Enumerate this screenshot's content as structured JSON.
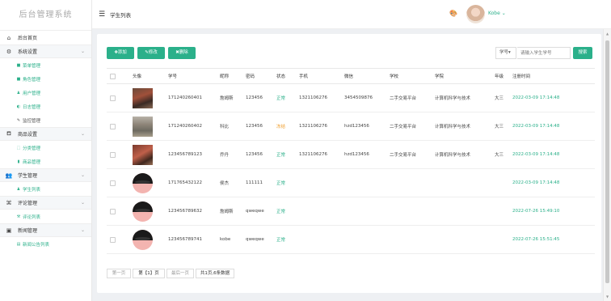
{
  "sidebar": {
    "logo": "后台管理系统",
    "home": "后台首页",
    "groups": [
      {
        "label": "系统设置",
        "items": [
          {
            "label": "菜单管理",
            "icon": "■"
          },
          {
            "label": "角色管理",
            "icon": "■"
          },
          {
            "label": "用户管理",
            "icon": "♟"
          },
          {
            "label": "日志管理",
            "icon": "◐"
          },
          {
            "label": "监控管理",
            "icon": "✎"
          }
        ]
      },
      {
        "label": "商品设置",
        "items": [
          {
            "label": "分类管理",
            "icon": "⬚"
          },
          {
            "label": "商品管理",
            "icon": "▮"
          }
        ]
      },
      {
        "label": "学生管理",
        "items": [
          {
            "label": "学生列表",
            "icon": "♟"
          }
        ]
      },
      {
        "label": "评论管理",
        "items": [
          {
            "label": "评论列表",
            "icon": "⚒"
          }
        ]
      },
      {
        "label": "新闻管理",
        "items": [
          {
            "label": "新闻公告列表",
            "icon": "▤"
          }
        ]
      }
    ]
  },
  "header": {
    "title": "学生列表",
    "username": "Kobe"
  },
  "toolbar": {
    "add": "添加",
    "edit": "修改",
    "delete": "删除",
    "search_field": "学号",
    "search_placeholder": "请输入学生学号",
    "search_button": "搜索"
  },
  "table": {
    "columns": [
      "头像",
      "学号",
      "昵称",
      "密码",
      "状态",
      "手机",
      "微信",
      "学校",
      "学院",
      "年级",
      "注册时间"
    ],
    "rows": [
      {
        "avatar": "ph1",
        "student_no": "171240260401",
        "nickname": "詹姆斯",
        "password": "123456",
        "status": "正常",
        "status_type": "normal",
        "phone": "1321106276",
        "wechat": "3454509876",
        "school": "二手交易平台",
        "college": "计算机科学与技术",
        "grade": "大三",
        "registered": "2022-03-09 17:14:48"
      },
      {
        "avatar": "ph2",
        "student_no": "171240260402",
        "nickname": "科比",
        "password": "123456",
        "status": "冻结",
        "status_type": "frozen",
        "phone": "1321106276",
        "wechat": "hzd123456",
        "school": "二手交易平台",
        "college": "计算机科学与技术",
        "grade": "大三",
        "registered": "2022-03-09 17:14:48"
      },
      {
        "avatar": "ph3",
        "student_no": "123456789123",
        "nickname": "乔丹",
        "password": "123456",
        "status": "正常",
        "status_type": "normal",
        "phone": "1321106276",
        "wechat": "hzd123456",
        "school": "二手交易平台",
        "college": "计算机科学与技术",
        "grade": "大三",
        "registered": "2022-03-09 17:14:48"
      },
      {
        "avatar": "round",
        "student_no": "171765432122",
        "nickname": "侯杰",
        "password": "111111",
        "status": "正常",
        "status_type": "normal",
        "phone": "",
        "wechat": "",
        "school": "",
        "college": "",
        "grade": "",
        "registered": "2022-03-09 17:14:48"
      },
      {
        "avatar": "round",
        "student_no": "123456789632",
        "nickname": "詹姆斯",
        "password": "qweqwe",
        "status": "正常",
        "status_type": "normal",
        "phone": "",
        "wechat": "",
        "school": "",
        "college": "",
        "grade": "",
        "registered": "2022-07-26 15:49:10"
      },
      {
        "avatar": "round",
        "student_no": "123456789741",
        "nickname": "kobe",
        "password": "qweqwe",
        "status": "正常",
        "status_type": "normal",
        "phone": "",
        "wechat": "",
        "school": "",
        "college": "",
        "grade": "",
        "registered": "2022-07-26 15:51:45"
      }
    ]
  },
  "pagination": {
    "first": "第一页",
    "current": "第【1】页",
    "last": "最后一页",
    "summary": "共1页,6条数据"
  },
  "colors": {
    "accent": "#2bb08a",
    "frozen": "#f0a030"
  }
}
